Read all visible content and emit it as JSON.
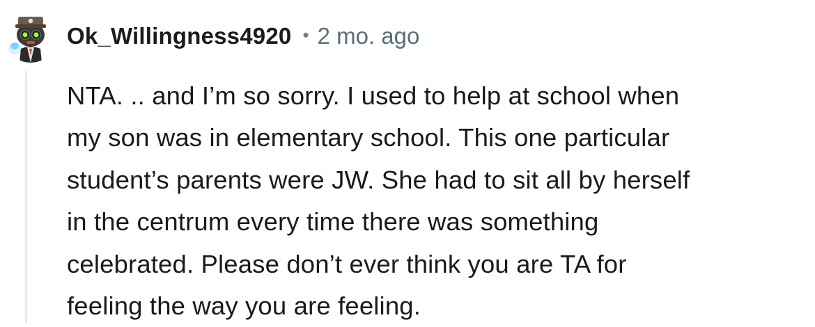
{
  "comment": {
    "username": "Ok_Willingness4920",
    "separator": "•",
    "timestamp": "2 mo. ago",
    "avatar_icon": "snoo-avatar-icon",
    "body_lines": [
      "NTA. .. and I’m so sorry. I used to help at school when",
      "my son was in elementary school. This one particular",
      "student’s parents were JW. She had to sit all by herself",
      "in the centrum every time there was something",
      "celebrated. Please don’t ever think you are TA for",
      "feeling the way you are feeling."
    ]
  },
  "colors": {
    "username": "#1c1c1c",
    "timestamp": "#576f76",
    "body": "#1a1a1b",
    "thread_line": "#e5ebee"
  }
}
